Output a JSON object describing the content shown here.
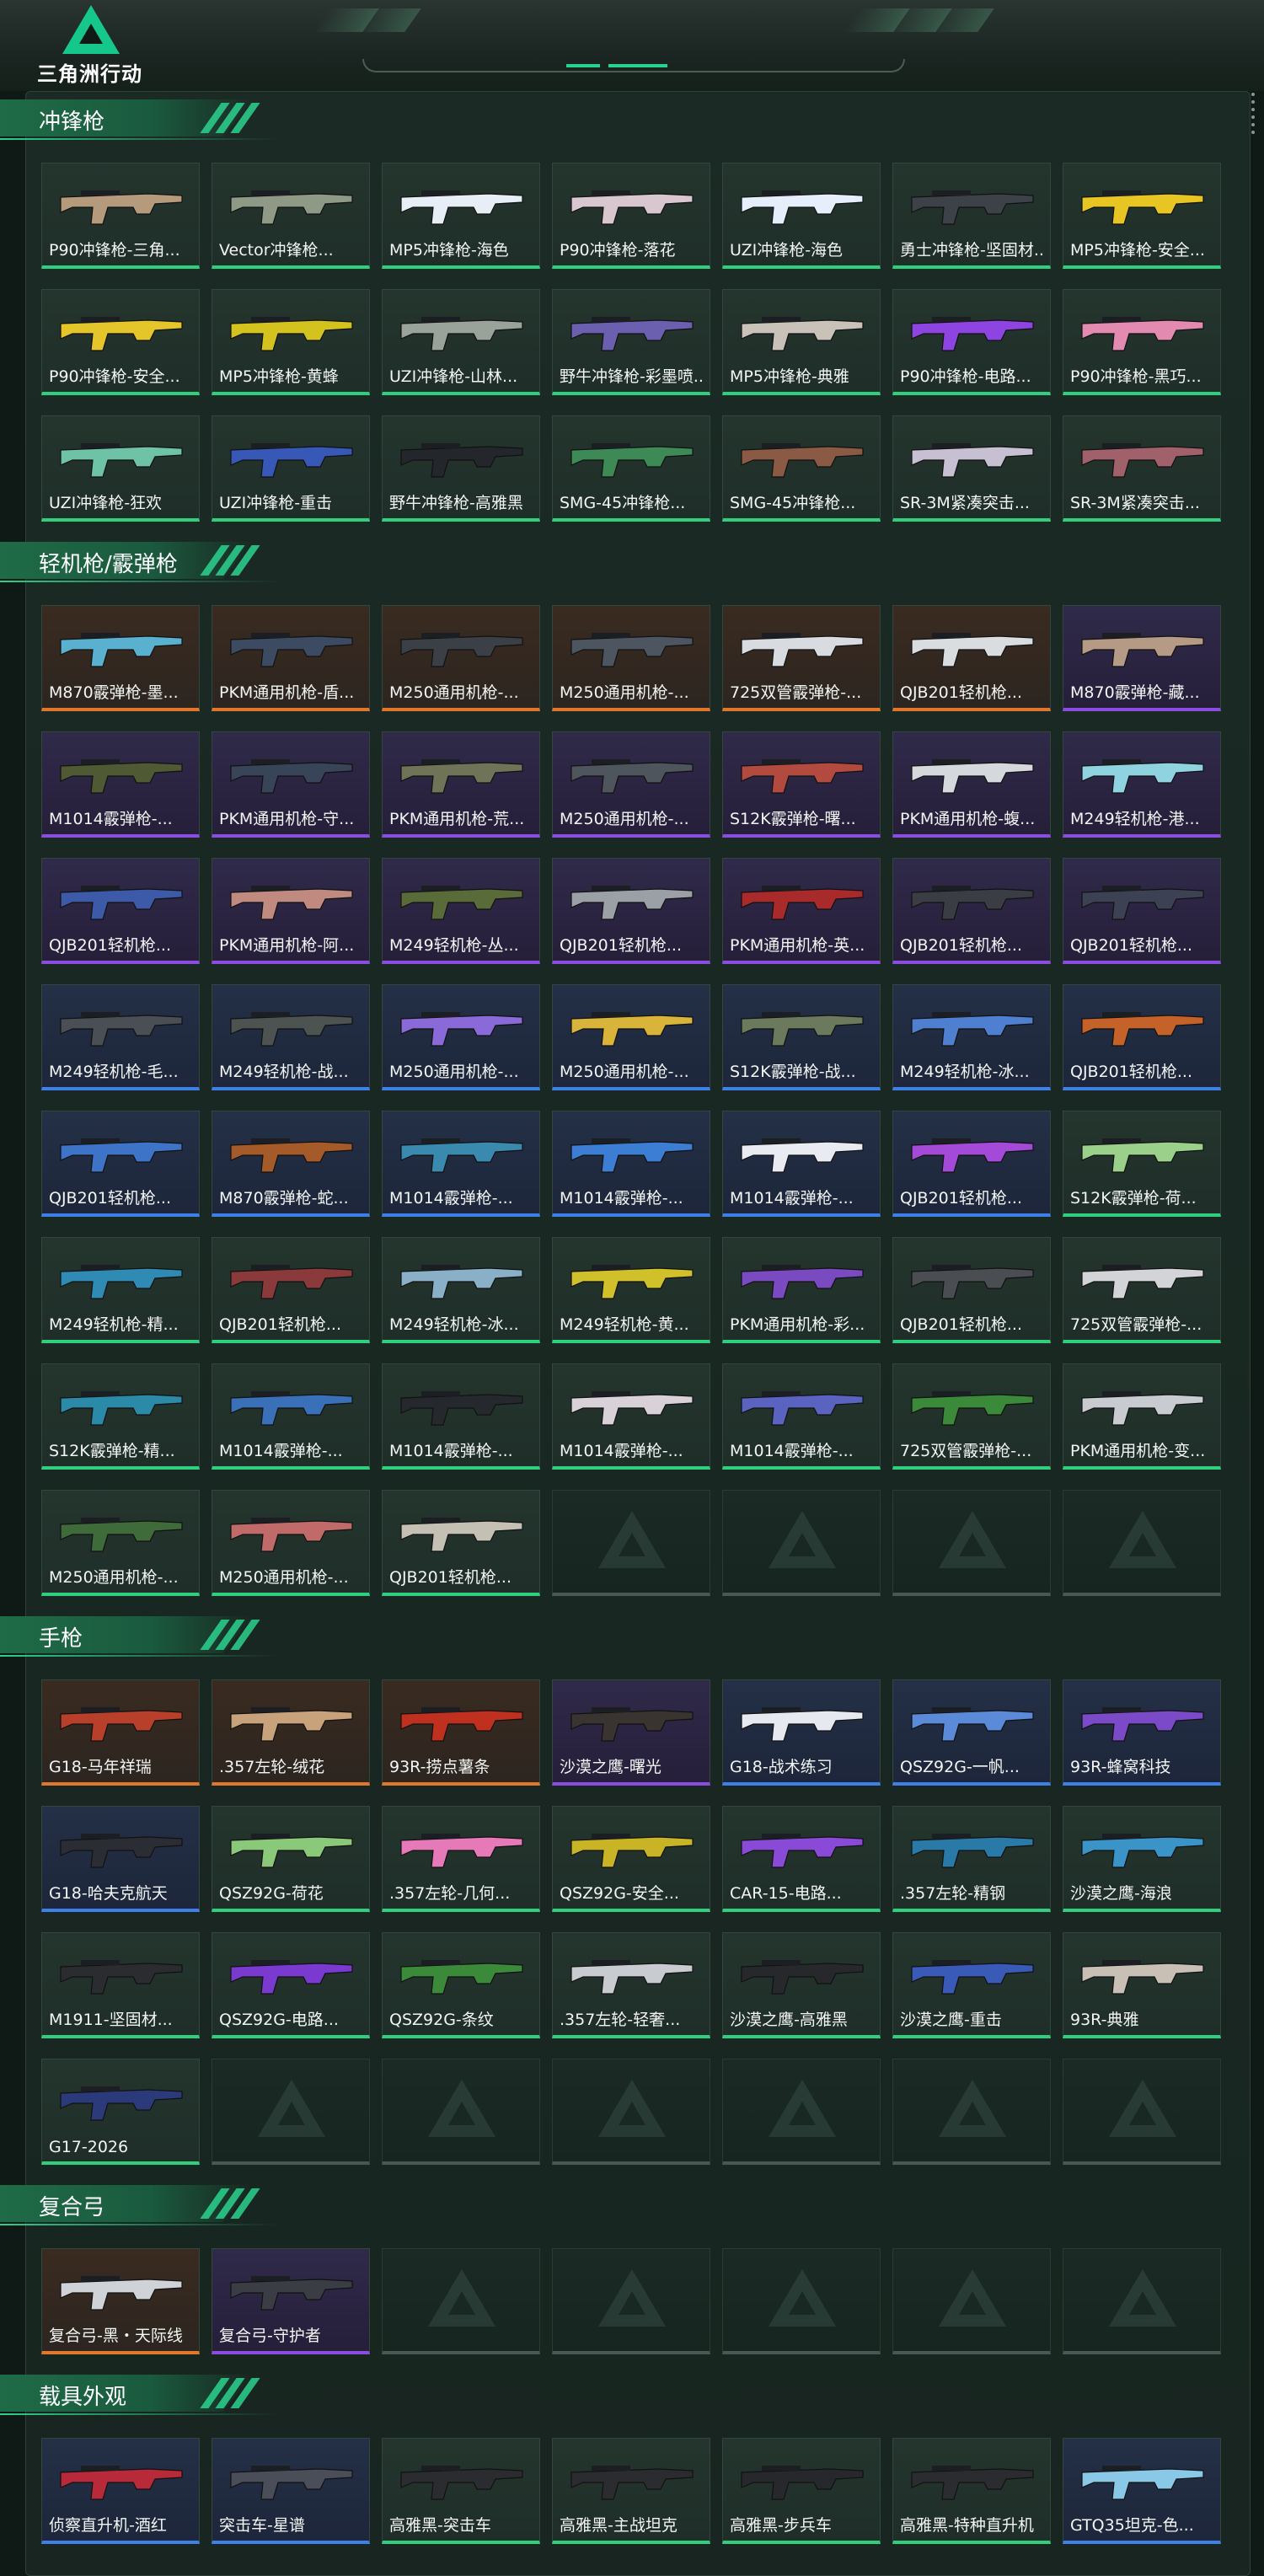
{
  "app": {
    "logo_text": "三角洲行动"
  },
  "colors": {
    "accent": "#2bd28e",
    "orange": "#e0772a",
    "purple": "#8a4de0",
    "blue": "#3f7fe8",
    "green": "#2fcf7e"
  },
  "sections": [
    {
      "id": "smg",
      "title": "冲锋枪",
      "items": [
        {
          "name": "P90冲锋枪-三角...",
          "quality": "green",
          "tint": "#b59a7c"
        },
        {
          "name": "Vector冲锋枪...",
          "quality": "green",
          "tint": "#8f9a86"
        },
        {
          "name": "MP5冲锋枪-海色",
          "quality": "green",
          "tint": "#e7eef5"
        },
        {
          "name": "P90冲锋枪-落花",
          "quality": "green",
          "tint": "#d8c7cf"
        },
        {
          "name": "UZI冲锋枪-海色",
          "quality": "green",
          "tint": "#e6eefb"
        },
        {
          "name": "勇士冲锋枪-坚固材...",
          "quality": "green",
          "tint": "#3c4247"
        },
        {
          "name": "MP5冲锋枪-安全...",
          "quality": "green",
          "tint": "#e7c623"
        },
        {
          "name": "P90冲锋枪-安全...",
          "quality": "green",
          "tint": "#e4c52a"
        },
        {
          "name": "MP5冲锋枪-黄蜂",
          "quality": "green",
          "tint": "#d4c21e"
        },
        {
          "name": "UZI冲锋枪-山林...",
          "quality": "green",
          "tint": "#9aa39a"
        },
        {
          "name": "野牛冲锋枪-彩墨喷...",
          "quality": "green",
          "tint": "#6b5fb0"
        },
        {
          "name": "MP5冲锋枪-典雅",
          "quality": "green",
          "tint": "#c9c2b8"
        },
        {
          "name": "P90冲锋枪-电路...",
          "quality": "green",
          "tint": "#8e44e0"
        },
        {
          "name": "P90冲锋枪-黑巧...",
          "quality": "green",
          "tint": "#e28ab0"
        },
        {
          "name": "UZI冲锋枪-狂欢",
          "quality": "green",
          "tint": "#6ec2a5"
        },
        {
          "name": "UZI冲锋枪-重击",
          "quality": "green",
          "tint": "#3858b8"
        },
        {
          "name": "野牛冲锋枪-高雅黑",
          "quality": "green",
          "tint": "#23262a"
        },
        {
          "name": "SMG-45冲锋枪...",
          "quality": "green",
          "tint": "#3d8a56"
        },
        {
          "name": "SMG-45冲锋枪...",
          "quality": "green",
          "tint": "#8a5a45"
        },
        {
          "name": "SR-3M紧凑突击...",
          "quality": "green",
          "tint": "#c7bfd2"
        },
        {
          "name": "SR-3M紧凑突击...",
          "quality": "green",
          "tint": "#a0616a"
        }
      ]
    },
    {
      "id": "lmg",
      "title": "轻机枪/霰弹枪",
      "items": [
        {
          "name": "M870霰弹枪-墨...",
          "quality": "orange",
          "tint": "#5ab0cf"
        },
        {
          "name": "PKM通用机枪-盾...",
          "quality": "orange",
          "tint": "#3c4a62"
        },
        {
          "name": "M250通用机枪-...",
          "quality": "orange",
          "tint": "#3b4047"
        },
        {
          "name": "M250通用机枪-...",
          "quality": "orange",
          "tint": "#4c5560"
        },
        {
          "name": "725双管霰弹枪-...",
          "quality": "orange",
          "tint": "#d8dbe0"
        },
        {
          "name": "QJB201轻机枪...",
          "quality": "orange",
          "tint": "#d9dde0"
        },
        {
          "name": "M870霰弹枪-藏...",
          "quality": "purple",
          "tint": "#b59a85"
        },
        {
          "name": "M1014霰弹枪-...",
          "quality": "purple",
          "tint": "#4f5a34"
        },
        {
          "name": "PKM通用机枪-守...",
          "quality": "purple",
          "tint": "#384458"
        },
        {
          "name": "PKM通用机枪-荒...",
          "quality": "purple",
          "tint": "#6f7458"
        },
        {
          "name": "M250通用机枪-...",
          "quality": "purple",
          "tint": "#4f555c"
        },
        {
          "name": "S12K霰弹枪-曙...",
          "quality": "purple",
          "tint": "#b34a3f"
        },
        {
          "name": "PKM通用机枪-蝮...",
          "quality": "purple",
          "tint": "#d5d8dc"
        },
        {
          "name": "M249轻机枪-港...",
          "quality": "purple",
          "tint": "#8fd2e0"
        },
        {
          "name": "QJB201轻机枪...",
          "quality": "purple",
          "tint": "#3c5aa8"
        },
        {
          "name": "PKM通用机枪-阿...",
          "quality": "purple",
          "tint": "#c08a80"
        },
        {
          "name": "M249轻机枪-丛...",
          "quality": "purple",
          "tint": "#5a6b3a"
        },
        {
          "name": "QJB201轻机枪...",
          "quality": "purple",
          "tint": "#9aa0a6"
        },
        {
          "name": "PKM通用机枪-英...",
          "quality": "purple",
          "tint": "#a82a2a"
        },
        {
          "name": "QJB201轻机枪...",
          "quality": "purple",
          "tint": "#3a3e44"
        },
        {
          "name": "QJB201轻机枪...",
          "quality": "purple",
          "tint": "#3c4254"
        },
        {
          "name": "M249轻机枪-毛...",
          "quality": "blue",
          "tint": "#4a4e55"
        },
        {
          "name": "M249轻机枪-战...",
          "quality": "blue",
          "tint": "#4c5350"
        },
        {
          "name": "M250通用机枪-...",
          "quality": "blue",
          "tint": "#8a6ad8"
        },
        {
          "name": "M250通用机枪-...",
          "quality": "blue",
          "tint": "#d8b43a"
        },
        {
          "name": "S12K霰弹枪-战...",
          "quality": "blue",
          "tint": "#6b7a5c"
        },
        {
          "name": "M249轻机枪-冰...",
          "quality": "blue",
          "tint": "#4e7fd0"
        },
        {
          "name": "QJB201轻机枪...",
          "quality": "blue",
          "tint": "#c4622a"
        },
        {
          "name": "QJB201轻机枪...",
          "quality": "blue",
          "tint": "#3e74c8"
        },
        {
          "name": "M870霰弹枪-蛇...",
          "quality": "blue",
          "tint": "#a55a2a"
        },
        {
          "name": "M1014霰弹枪-...",
          "quality": "blue",
          "tint": "#3a8ab0"
        },
        {
          "name": "M1014霰弹枪-...",
          "quality": "blue",
          "tint": "#3b7ed4"
        },
        {
          "name": "M1014霰弹枪-...",
          "quality": "blue",
          "tint": "#e8ecf2"
        },
        {
          "name": "QJB201轻机枪...",
          "quality": "blue",
          "tint": "#a44ad8"
        },
        {
          "name": "S12K霰弹枪-荷...",
          "quality": "green",
          "tint": "#9ad08a"
        },
        {
          "name": "M249轻机枪-精...",
          "quality": "green",
          "tint": "#2f8ab4"
        },
        {
          "name": "QJB201轻机枪...",
          "quality": "green",
          "tint": "#8a3a3a"
        },
        {
          "name": "M249轻机枪-冰...",
          "quality": "green",
          "tint": "#8ab0c8"
        },
        {
          "name": "M249轻机枪-黄...",
          "quality": "green",
          "tint": "#d0c02a"
        },
        {
          "name": "PKM通用机枪-彩...",
          "quality": "green",
          "tint": "#7a4ac0"
        },
        {
          "name": "QJB201轻机枪...",
          "quality": "green",
          "tint": "#4a4e52"
        },
        {
          "name": "725双管霰弹枪-...",
          "quality": "green",
          "tint": "#d2d4d8"
        },
        {
          "name": "S12K霰弹枪-精...",
          "quality": "green",
          "tint": "#2a8aa8"
        },
        {
          "name": "M1014霰弹枪-...",
          "quality": "green",
          "tint": "#3a70b8"
        },
        {
          "name": "M1014霰弹枪-...",
          "quality": "green",
          "tint": "#25282c"
        },
        {
          "name": "M1014霰弹枪-...",
          "quality": "green",
          "tint": "#d8d2d8"
        },
        {
          "name": "M1014霰弹枪-...",
          "quality": "green",
          "tint": "#5a64c0"
        },
        {
          "name": "725双管霰弹枪-...",
          "quality": "green",
          "tint": "#3a8a3a"
        },
        {
          "name": "PKM通用机枪-变...",
          "quality": "green",
          "tint": "#c8ccd0"
        },
        {
          "name": "M250通用机枪-...",
          "quality": "green",
          "tint": "#3f6b3a"
        },
        {
          "name": "M250通用机枪-...",
          "quality": "green",
          "tint": "#c06a6a"
        },
        {
          "name": "QJB201轻机枪...",
          "quality": "green",
          "tint": "#c4c0b4"
        }
      ]
    },
    {
      "id": "pistol",
      "title": "手枪",
      "items": [
        {
          "name": "G18-马年祥瑞",
          "quality": "orange",
          "tint": "#b8402a"
        },
        {
          "name": ".357左轮-绒花",
          "quality": "orange",
          "tint": "#c8a27a"
        },
        {
          "name": "93R-捞点薯条",
          "quality": "orange",
          "tint": "#c0301e"
        },
        {
          "name": "沙漠之鹰-曙光",
          "quality": "purple",
          "tint": "#3a3430"
        },
        {
          "name": "G18-战术练习",
          "quality": "blue",
          "tint": "#e6eaf0"
        },
        {
          "name": "QSZ92G-一帆...",
          "quality": "blue",
          "tint": "#5a8ad8"
        },
        {
          "name": "93R-蜂窝科技",
          "quality": "blue",
          "tint": "#7a4ac8"
        },
        {
          "name": "G18-哈夫克航天",
          "quality": "blue",
          "tint": "#2a2e34"
        },
        {
          "name": "QSZ92G-荷花",
          "quality": "green",
          "tint": "#8ac87a"
        },
        {
          "name": ".357左轮-几何...",
          "quality": "green",
          "tint": "#e67ab8"
        },
        {
          "name": "QSZ92G-安全...",
          "quality": "green",
          "tint": "#c8b424"
        },
        {
          "name": "CAR-15-电路...",
          "quality": "green",
          "tint": "#8a4ad8"
        },
        {
          "name": ".357左轮-精钢",
          "quality": "green",
          "tint": "#2a7aa8"
        },
        {
          "name": "沙漠之鹰-海浪",
          "quality": "green",
          "tint": "#3a94c8"
        },
        {
          "name": "M1911-坚固材...",
          "quality": "green",
          "tint": "#2a2c30"
        },
        {
          "name": "QSZ92G-电路...",
          "quality": "green",
          "tint": "#7a3ad0"
        },
        {
          "name": "QSZ92G-条纹",
          "quality": "green",
          "tint": "#3a8a3a"
        },
        {
          "name": ".357左轮-轻奢...",
          "quality": "green",
          "tint": "#c8ccd0"
        },
        {
          "name": "沙漠之鹰-高雅黑",
          "quality": "green",
          "tint": "#26282c"
        },
        {
          "name": "沙漠之鹰-重击",
          "quality": "green",
          "tint": "#3a5ab8"
        },
        {
          "name": "93R-典雅",
          "quality": "green",
          "tint": "#c8c0b4"
        },
        {
          "name": "G17-2026",
          "quality": "green",
          "tint": "#2a3a7a"
        }
      ]
    },
    {
      "id": "bow",
      "title": "复合弓",
      "items": [
        {
          "name": "复合弓-黑・天际线",
          "quality": "orange",
          "tint": "#cfd2d6"
        },
        {
          "name": "复合弓-守护者",
          "quality": "purple",
          "tint": "#3a3e44"
        }
      ]
    },
    {
      "id": "vehicle",
      "title": "载具外观",
      "items": [
        {
          "name": "侦察直升机-酒红",
          "quality": "blue",
          "tint": "#b82a3a"
        },
        {
          "name": "突击车-星谱",
          "quality": "blue",
          "tint": "#4a4e58"
        },
        {
          "name": "高雅黑-突击车",
          "quality": "green",
          "tint": "#2a2c30"
        },
        {
          "name": "高雅黑-主战坦克",
          "quality": "green",
          "tint": "#2a2c30"
        },
        {
          "name": "高雅黑-步兵车",
          "quality": "green",
          "tint": "#26282c"
        },
        {
          "name": "高雅黑-特种直升机",
          "quality": "green",
          "tint": "#2a2c30"
        },
        {
          "name": "GTQ35坦克-色...",
          "quality": "blue",
          "tint": "#8ac8e8"
        }
      ]
    }
  ]
}
